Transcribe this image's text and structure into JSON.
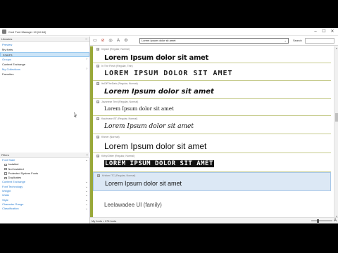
{
  "window": {
    "title": "Cool Font Manager 10 (64 bit)",
    "minimize": "–",
    "maximize": "☐",
    "close": "✕"
  },
  "sidebar": {
    "libraries_label": "Libraries",
    "libraries": [
      {
        "label": "Preview",
        "blue": true,
        "chev": ""
      },
      {
        "label": "My fonts",
        "blue": false,
        "chev": ""
      },
      {
        "label": "FONTS",
        "blue": false,
        "selected": true,
        "chev": ""
      },
      {
        "label": "Groups",
        "blue": true,
        "chev": "›"
      },
      {
        "label": "Content Exchange",
        "blue": false,
        "chev": ""
      },
      {
        "label": "My Collections",
        "blue": true,
        "chev": "›"
      },
      {
        "label": "Favorites",
        "blue": false,
        "chev": ""
      }
    ],
    "filters_label": "Filters",
    "font_state_label": "Font State",
    "font_state_options": [
      "Installed",
      "Not Installed",
      "Protected System Fonts",
      "Duplicates"
    ],
    "filter_groups": [
      "Content Exchange",
      "Font Technology",
      "Weight",
      "Width",
      "Style",
      "Character Range",
      "Classification"
    ]
  },
  "toolbar": {
    "preview_text": "Lorem Ipsum dolor sit amet",
    "search_label": "Search"
  },
  "fonts": [
    {
      "meta": "Impact (Regular, Normal)",
      "sample": "Lorem Ipsum dolor sit amet"
    },
    {
      "meta": "In The Flesh (Regular, Thin)",
      "sample": "LOREM IPSUM DOLOR SIT AMET"
    },
    {
      "meta": "ItsOffTheDark (Regular, Normal)",
      "sample": "Lorem Ipsum dolor sit amet"
    },
    {
      "meta": "Javanese Text (Regular, Normal)",
      "sample": "Lorem Ipsum dolor sit amet"
    },
    {
      "meta": "Kaufmann BT (Regular, Normal)",
      "sample": "Lorem Ipsum dolor sit amet"
    },
    {
      "meta": "Khmer (Normal)",
      "sample": "Lorem Ipsum dolor sit amet"
    },
    {
      "meta": "KirbyGlitter (Regular, Normal)",
      "sample": "LOREM IPSUM DOLOR SIT AMET"
    },
    {
      "meta": "Kristen ITC (Regular, Normal)",
      "sample": "Lorem Ipsum dolor sit amet"
    },
    {
      "meta": "",
      "sample": "Leelawadee UI (family)"
    }
  ],
  "status": {
    "text": "My fonts • 176 fonts",
    "zoom_icon": "A"
  },
  "colors": {
    "accent": "#2d7fd1",
    "stripe": "#99a83a",
    "selection": "#dce8f5"
  }
}
